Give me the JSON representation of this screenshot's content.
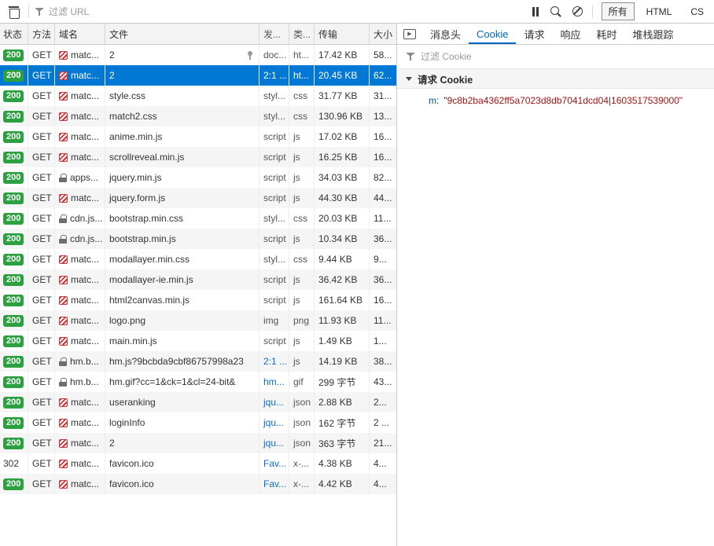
{
  "colors": {
    "accent_selected_row": "#0078d4",
    "status_ok_green": "#2da042",
    "tab_active_blue": "#0067c0",
    "link_blue": "#0b6bcb",
    "blocked_icon_red": "#d13438",
    "cookie_key_blue": "#0451a5",
    "cookie_value_red": "#a31515"
  },
  "toolbar": {
    "url_filter_placeholder": "过滤 URL",
    "type_filters": [
      {
        "label": "所有",
        "name": "all",
        "active": true
      },
      {
        "label": "HTML",
        "name": "html",
        "active": false
      },
      {
        "label": "CS",
        "name": "css",
        "active": false
      }
    ]
  },
  "table": {
    "columns": [
      "状态",
      "方法",
      "域名",
      "文件",
      "发...",
      "类...",
      "传输",
      "大小"
    ],
    "rows": [
      {
        "status": "200",
        "ok": true,
        "method": "GET",
        "icon": "blocked",
        "domain": "matc...",
        "file": "2",
        "pin": true,
        "init": "doc...",
        "initLink": false,
        "type": "ht...",
        "trans": "17.42 KB",
        "size": "58..."
      },
      {
        "status": "200",
        "ok": true,
        "method": "GET",
        "icon": "blocked",
        "domain": "matc...",
        "file": "2",
        "init": "2:1 ...",
        "initLink": true,
        "type": "ht...",
        "trans": "20.45 KB",
        "size": "62...",
        "selected": true
      },
      {
        "status": "200",
        "ok": true,
        "method": "GET",
        "icon": "blocked",
        "domain": "matc...",
        "file": "style.css",
        "init": "styl...",
        "initLink": false,
        "type": "css",
        "trans": "31.77 KB",
        "size": "31..."
      },
      {
        "status": "200",
        "ok": true,
        "method": "GET",
        "icon": "blocked",
        "domain": "matc...",
        "file": "match2.css",
        "init": "styl...",
        "initLink": false,
        "type": "css",
        "trans": "130.96 KB",
        "size": "13..."
      },
      {
        "status": "200",
        "ok": true,
        "method": "GET",
        "icon": "blocked",
        "domain": "matc...",
        "file": "anime.min.js",
        "init": "script",
        "initLink": false,
        "type": "js",
        "trans": "17.02 KB",
        "size": "16..."
      },
      {
        "status": "200",
        "ok": true,
        "method": "GET",
        "icon": "blocked",
        "domain": "matc...",
        "file": "scrollreveal.min.js",
        "init": "script",
        "initLink": false,
        "type": "js",
        "trans": "16.25 KB",
        "size": "16..."
      },
      {
        "status": "200",
        "ok": true,
        "method": "GET",
        "icon": "lock",
        "domain": "apps...",
        "file": "jquery.min.js",
        "init": "script",
        "initLink": false,
        "type": "js",
        "trans": "34.03 KB",
        "size": "82..."
      },
      {
        "status": "200",
        "ok": true,
        "method": "GET",
        "icon": "blocked",
        "domain": "matc...",
        "file": "jquery.form.js",
        "init": "script",
        "initLink": false,
        "type": "js",
        "trans": "44.30 KB",
        "size": "44..."
      },
      {
        "status": "200",
        "ok": true,
        "method": "GET",
        "icon": "lock",
        "domain": "cdn.js...",
        "file": "bootstrap.min.css",
        "init": "styl...",
        "initLink": false,
        "type": "css",
        "trans": "20.03 KB",
        "size": "11..."
      },
      {
        "status": "200",
        "ok": true,
        "method": "GET",
        "icon": "lock",
        "domain": "cdn.js...",
        "file": "bootstrap.min.js",
        "init": "script",
        "initLink": false,
        "type": "js",
        "trans": "10.34 KB",
        "size": "36..."
      },
      {
        "status": "200",
        "ok": true,
        "method": "GET",
        "icon": "blocked",
        "domain": "matc...",
        "file": "modallayer.min.css",
        "init": "styl...",
        "initLink": false,
        "type": "css",
        "trans": "9.44 KB",
        "size": "9..."
      },
      {
        "status": "200",
        "ok": true,
        "method": "GET",
        "icon": "blocked",
        "domain": "matc...",
        "file": "modallayer-ie.min.js",
        "init": "script",
        "initLink": false,
        "type": "js",
        "trans": "36.42 KB",
        "size": "36..."
      },
      {
        "status": "200",
        "ok": true,
        "method": "GET",
        "icon": "blocked",
        "domain": "matc...",
        "file": "html2canvas.min.js",
        "init": "script",
        "initLink": false,
        "type": "js",
        "trans": "161.64 KB",
        "size": "16..."
      },
      {
        "status": "200",
        "ok": true,
        "method": "GET",
        "icon": "blocked",
        "domain": "matc...",
        "file": "logo.png",
        "init": "img",
        "initLink": false,
        "type": "png",
        "trans": "11.93 KB",
        "size": "11..."
      },
      {
        "status": "200",
        "ok": true,
        "method": "GET",
        "icon": "blocked",
        "domain": "matc...",
        "file": "main.min.js",
        "init": "script",
        "initLink": false,
        "type": "js",
        "trans": "1.49 KB",
        "size": "1..."
      },
      {
        "status": "200",
        "ok": true,
        "method": "GET",
        "icon": "lock",
        "domain": "hm.b...",
        "file": "hm.js?9bcbda9cbf86757998a23",
        "init": "2:1 ...",
        "initLink": true,
        "type": "js",
        "trans": "14.19 KB",
        "size": "38..."
      },
      {
        "status": "200",
        "ok": true,
        "method": "GET",
        "icon": "lock",
        "domain": "hm.b...",
        "file": "hm.gif?cc=1&ck=1&cl=24-bit&",
        "init": "hm...",
        "initLink": true,
        "type": "gif",
        "trans": "299 字节",
        "size": "43..."
      },
      {
        "status": "200",
        "ok": true,
        "method": "GET",
        "icon": "blocked",
        "domain": "matc...",
        "file": "useranking",
        "init": "jqu...",
        "initLink": true,
        "type": "json",
        "trans": "2.88 KB",
        "size": "2..."
      },
      {
        "status": "200",
        "ok": true,
        "method": "GET",
        "icon": "blocked",
        "domain": "matc...",
        "file": "loginInfo",
        "init": "jqu...",
        "initLink": true,
        "type": "json",
        "trans": "162 字节",
        "size": "2 ..."
      },
      {
        "status": "200",
        "ok": true,
        "method": "GET",
        "icon": "blocked",
        "domain": "matc...",
        "file": "2",
        "init": "jqu...",
        "initLink": true,
        "type": "json",
        "trans": "363 字节",
        "size": "21..."
      },
      {
        "status": "302",
        "ok": false,
        "method": "GET",
        "icon": "blocked",
        "domain": "matc...",
        "file": "favicon.ico",
        "init": "Fav...",
        "initLink": true,
        "type": "x-...",
        "trans": "4.38 KB",
        "size": "4..."
      },
      {
        "status": "200",
        "ok": true,
        "method": "GET",
        "icon": "blocked",
        "domain": "matc...",
        "file": "favicon.ico",
        "init": "Fav...",
        "initLink": true,
        "type": "x-...",
        "trans": "4.42 KB",
        "size": "4..."
      }
    ]
  },
  "details": {
    "tabs": [
      {
        "name": "preview",
        "icon": "play-box"
      },
      {
        "label": "消息头",
        "name": "headers",
        "active": false
      },
      {
        "label": "Cookie",
        "name": "cookie",
        "active": true
      },
      {
        "label": "请求",
        "name": "request",
        "active": false
      },
      {
        "label": "响应",
        "name": "response",
        "active": false
      },
      {
        "label": "耗时",
        "name": "timing",
        "active": false
      },
      {
        "label": "堆栈跟踪",
        "name": "stack-trace",
        "active": false
      }
    ],
    "cookie_filter_placeholder": "过滤 Cookie",
    "section_title": "请求 Cookie",
    "cookie_key": "m:",
    "cookie_value": "\"9c8b2ba4362ff5a7023d8db7041dcd04|1603517539000\""
  }
}
